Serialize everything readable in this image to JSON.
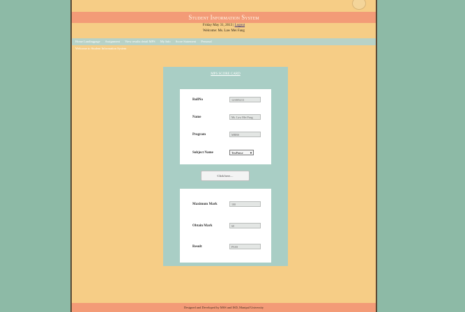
{
  "header": {
    "title": "Student Information System",
    "date": "Friday May 31, 2013",
    "logout_label": "Logout",
    "welcome": "Welcome: Ms. Law Mei Fang"
  },
  "nav": {
    "items": [
      "Home Landingpage",
      "Assignment",
      "View results detail MPS",
      "My Info",
      "Score Statement",
      "Personal"
    ]
  },
  "welcome_note": "Welcome to Student Information System",
  "score_card": {
    "title": "MPS SCORE CARD",
    "rollno_label": "RollNo",
    "rollno_value": "121005213",
    "name_label": "Name",
    "name_value": "Ms. Law Mei Fang",
    "program_label": "Program",
    "program_value": "MBBS",
    "subject_label": "Subject Name",
    "subject_value": "TestPrmse",
    "button_label": "Click here....",
    "max_label": "Maximum Mark",
    "max_value": "100",
    "obtain_label": "Obtain Mark",
    "obtain_value": "60",
    "result_label": "Result",
    "result_value": "PASS"
  },
  "footer": "Designed and Developed by MSS and ISD, Manipal University"
}
